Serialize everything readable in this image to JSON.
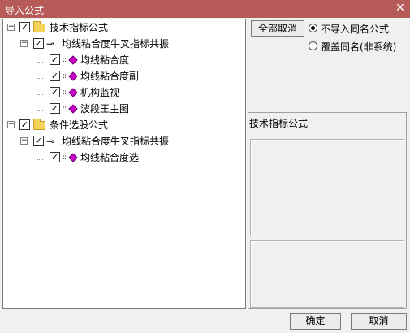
{
  "window": {
    "title": "导入公式",
    "close_glyph": "✕"
  },
  "tree": {
    "groups": [
      {
        "label": "技术指标公式",
        "checked": true,
        "formula": {
          "label": "均线粘合度牛叉指标共振",
          "checked": true,
          "items": [
            {
              "label": "均线粘合度",
              "checked": true
            },
            {
              "label": "均线粘合度副",
              "checked": true
            },
            {
              "label": "机构监视",
              "checked": true
            },
            {
              "label": "波段王主图",
              "checked": true
            }
          ]
        }
      },
      {
        "label": "条件选股公式",
        "checked": true,
        "formula": {
          "label": "均线粘合度牛叉指标共振",
          "checked": true,
          "items": [
            {
              "label": "均线粘合度选",
              "checked": true
            }
          ]
        }
      }
    ],
    "icons": {
      "expander": "−",
      "check": "✓",
      "key": "⊸",
      "dash": "::"
    }
  },
  "right": {
    "deselect_all_label": "全部取消",
    "options": [
      {
        "label": "不导入同名公式",
        "selected": true
      },
      {
        "label": "覆盖同名(非系统)",
        "selected": false
      }
    ],
    "info_title": "技术指标公式"
  },
  "footer": {
    "ok_label": "确定",
    "cancel_label": "取消"
  }
}
